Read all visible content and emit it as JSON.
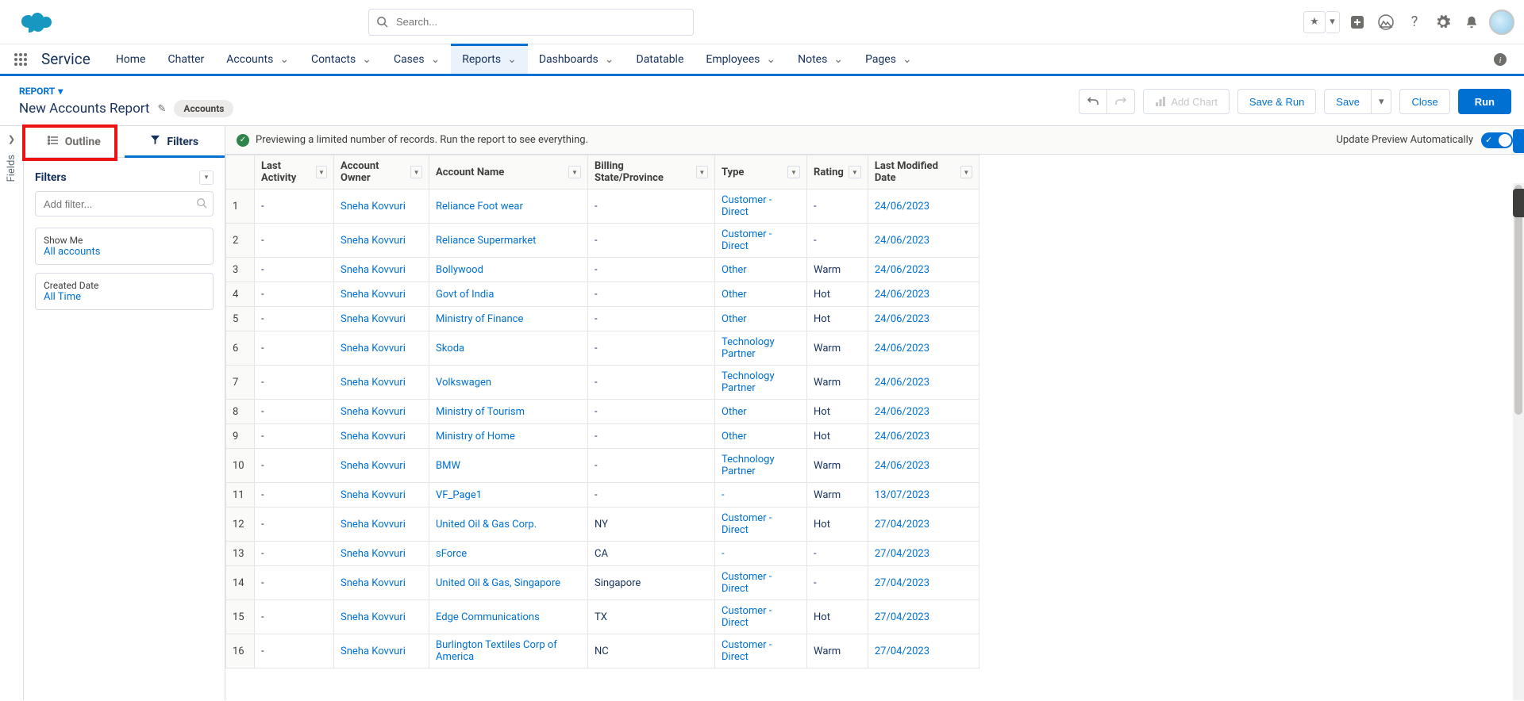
{
  "search": {
    "placeholder": "Search..."
  },
  "app_name": "Service",
  "nav": [
    {
      "label": "Home"
    },
    {
      "label": "Chatter"
    },
    {
      "label": "Accounts",
      "chev": true
    },
    {
      "label": "Contacts",
      "chev": true
    },
    {
      "label": "Cases",
      "chev": true
    },
    {
      "label": "Reports",
      "chev": true,
      "active": true
    },
    {
      "label": "Dashboards",
      "chev": true
    },
    {
      "label": "Datatable"
    },
    {
      "label": "Employees",
      "chev": true
    },
    {
      "label": "Notes",
      "chev": true
    },
    {
      "label": "Pages",
      "chev": true
    }
  ],
  "crumb": "REPORT",
  "report_title": "New Accounts Report",
  "entity_pill": "Accounts",
  "buttons": {
    "add_chart": "Add Chart",
    "save_run": "Save & Run",
    "save": "Save",
    "close": "Close",
    "run": "Run"
  },
  "fields_tab": "Fields",
  "panel_tabs": {
    "outline": "Outline",
    "filters": "Filters"
  },
  "filters_panel": {
    "title": "Filters",
    "add_placeholder": "Add filter...",
    "cards": [
      {
        "label": "Show Me",
        "value": "All accounts"
      },
      {
        "label": "Created Date",
        "value": "All Time"
      }
    ]
  },
  "preview_msg": "Previewing a limited number of records. Run the report to see everything.",
  "auto_label": "Update Preview Automatically",
  "columns": [
    "Last Activity",
    "Account Owner",
    "Account Name",
    "Billing State/Province",
    "Type",
    "Rating",
    "Last Modified Date"
  ],
  "rows": [
    {
      "n": 1,
      "la": "-",
      "ow": "Sneha Kovvuri",
      "an": "Reliance Foot wear",
      "bs": "-",
      "ty": "Customer - Direct",
      "ra": "-",
      "lm": "24/06/2023"
    },
    {
      "n": 2,
      "la": "-",
      "ow": "Sneha Kovvuri",
      "an": "Reliance Supermarket",
      "bs": "-",
      "ty": "Customer - Direct",
      "ra": "-",
      "lm": "24/06/2023"
    },
    {
      "n": 3,
      "la": "-",
      "ow": "Sneha Kovvuri",
      "an": "Bollywood",
      "bs": "-",
      "ty": "Other",
      "ra": "Warm",
      "lm": "24/06/2023"
    },
    {
      "n": 4,
      "la": "-",
      "ow": "Sneha Kovvuri",
      "an": "Govt of India",
      "bs": "-",
      "ty": "Other",
      "ra": "Hot",
      "lm": "24/06/2023"
    },
    {
      "n": 5,
      "la": "-",
      "ow": "Sneha Kovvuri",
      "an": "Ministry of Finance",
      "bs": "-",
      "ty": "Other",
      "ra": "Hot",
      "lm": "24/06/2023"
    },
    {
      "n": 6,
      "la": "-",
      "ow": "Sneha Kovvuri",
      "an": "Skoda",
      "bs": "-",
      "ty": "Technology Partner",
      "ra": "Warm",
      "lm": "24/06/2023"
    },
    {
      "n": 7,
      "la": "-",
      "ow": "Sneha Kovvuri",
      "an": "Volkswagen",
      "bs": "-",
      "ty": "Technology Partner",
      "ra": "Warm",
      "lm": "24/06/2023"
    },
    {
      "n": 8,
      "la": "-",
      "ow": "Sneha Kovvuri",
      "an": "Ministry of Tourism",
      "bs": "-",
      "ty": "Other",
      "ra": "Hot",
      "lm": "24/06/2023"
    },
    {
      "n": 9,
      "la": "-",
      "ow": "Sneha Kovvuri",
      "an": "Ministry of Home",
      "bs": "-",
      "ty": "Other",
      "ra": "Hot",
      "lm": "24/06/2023"
    },
    {
      "n": 10,
      "la": "-",
      "ow": "Sneha Kovvuri",
      "an": "BMW",
      "bs": "-",
      "ty": "Technology Partner",
      "ra": "Warm",
      "lm": "24/06/2023"
    },
    {
      "n": 11,
      "la": "-",
      "ow": "Sneha Kovvuri",
      "an": "VF_Page1",
      "bs": "-",
      "ty": "-",
      "ra": "Warm",
      "lm": "13/07/2023"
    },
    {
      "n": 12,
      "la": "-",
      "ow": "Sneha Kovvuri",
      "an": "United Oil & Gas Corp.",
      "bs": "NY",
      "ty": "Customer - Direct",
      "ra": "Hot",
      "lm": "27/04/2023"
    },
    {
      "n": 13,
      "la": "-",
      "ow": "Sneha Kovvuri",
      "an": "sForce",
      "bs": "CA",
      "ty": "-",
      "ra": "-",
      "lm": "27/04/2023"
    },
    {
      "n": 14,
      "la": "-",
      "ow": "Sneha Kovvuri",
      "an": "United Oil & Gas, Singapore",
      "bs": "Singapore",
      "ty": "Customer - Direct",
      "ra": "-",
      "lm": "27/04/2023"
    },
    {
      "n": 15,
      "la": "-",
      "ow": "Sneha Kovvuri",
      "an": "Edge Communications",
      "bs": "TX",
      "ty": "Customer - Direct",
      "ra": "Hot",
      "lm": "27/04/2023"
    },
    {
      "n": 16,
      "la": "-",
      "ow": "Sneha Kovvuri",
      "an": "Burlington Textiles Corp of America",
      "bs": "NC",
      "ty": "Customer - Direct",
      "ra": "Warm",
      "lm": "27/04/2023"
    }
  ]
}
